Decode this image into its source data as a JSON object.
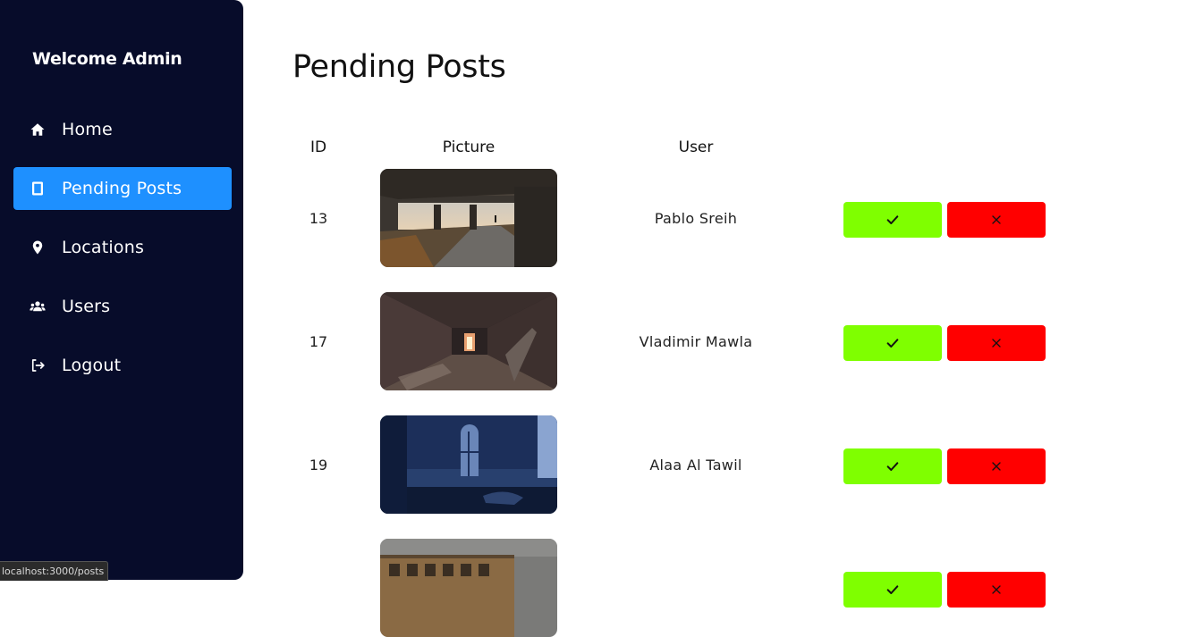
{
  "sidebar": {
    "welcome": "Welcome Admin",
    "items": [
      {
        "label": "Home",
        "icon": "home-icon",
        "active": false
      },
      {
        "label": "Pending Posts",
        "icon": "document-icon",
        "active": true
      },
      {
        "label": "Locations",
        "icon": "map-pin-icon",
        "active": false
      },
      {
        "label": "Users",
        "icon": "users-icon",
        "active": false
      },
      {
        "label": "Logout",
        "icon": "logout-icon",
        "active": false
      }
    ]
  },
  "main": {
    "title": "Pending Posts",
    "columns": {
      "id": "ID",
      "picture": "Picture",
      "user": "User"
    },
    "rows": [
      {
        "id": "13",
        "user": "Pablo Sreih",
        "picture": "abandoned-corridor-view"
      },
      {
        "id": "17",
        "user": "Vladimir Mawla",
        "picture": "ruined-hallway"
      },
      {
        "id": "19",
        "user": "Alaa Al Tawil",
        "picture": "dark-blue-room"
      },
      {
        "id": "",
        "user": "",
        "picture": "abandoned-building"
      }
    ],
    "actions": {
      "approve_icon": "check-icon",
      "reject_icon": "close-icon"
    }
  },
  "status_bar": {
    "url": "localhost:3000/posts"
  },
  "colors": {
    "sidebar_bg": "#070c2a",
    "active_item": "#1e90ff",
    "approve": "#7fff00",
    "reject": "#ff0000"
  }
}
